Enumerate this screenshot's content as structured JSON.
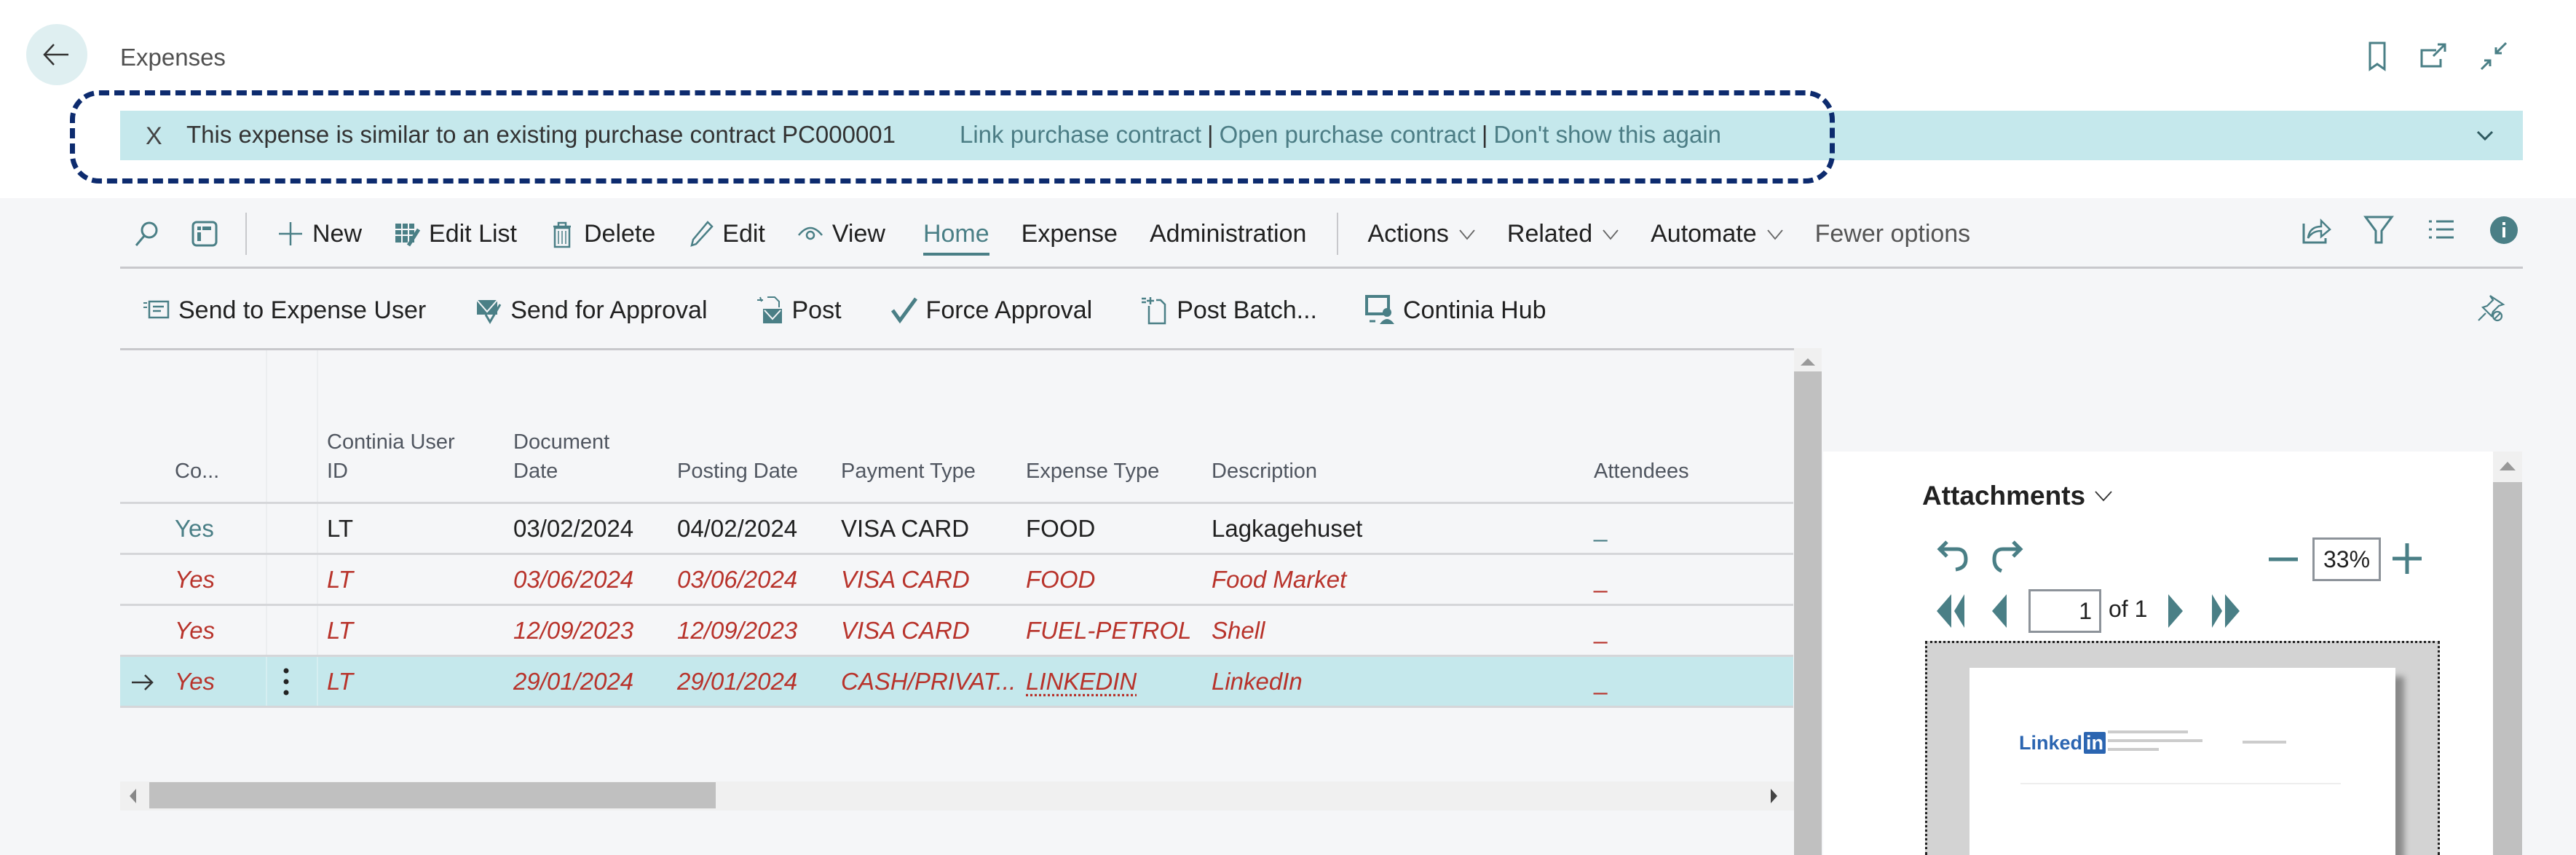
{
  "header": {
    "title": "Expenses",
    "icons": [
      "bookmark-icon",
      "open-new-window-icon",
      "collapse-icon"
    ]
  },
  "banner": {
    "close_glyph": "X",
    "message": "This expense is similar to an existing purchase contract PC000001",
    "actions": [
      "Link purchase contract",
      "Open purchase contract",
      "Don't show this again"
    ],
    "separator": "|",
    "highlight_color": "#0d2b6e",
    "background": "#c5e8ec"
  },
  "action_bar": {
    "buttons": [
      "New",
      "Edit List",
      "Delete",
      "Edit",
      "View"
    ],
    "tabs": [
      {
        "label": "Home",
        "active": true
      },
      {
        "label": "Expense",
        "active": false
      },
      {
        "label": "Administration",
        "active": false
      }
    ],
    "menus": [
      "Actions",
      "Related",
      "Automate"
    ],
    "fewer_options": "Fewer options"
  },
  "promoted_actions": [
    "Send to Expense User",
    "Send for Approval",
    "Post",
    "Force Approval",
    "Post Batch...",
    "Continia Hub"
  ],
  "table": {
    "columns": [
      "Co...",
      "Continia User ID",
      "Document Date",
      "Posting Date",
      "Payment Type",
      "Expense Type",
      "Description",
      "Attendees"
    ],
    "column_lines": {
      "user_id": [
        "Continia User",
        "ID"
      ],
      "doc_date": [
        "Document",
        "Date"
      ]
    },
    "rows": [
      {
        "completed": "Yes",
        "user": "LT",
        "doc_date": "03/02/2024",
        "post_date": "04/02/2024",
        "payment": "VISA CARD",
        "type": "FOOD",
        "description": "Lagkagehuset",
        "attendees": "_",
        "style": "normal",
        "selected": false
      },
      {
        "completed": "Yes",
        "user": "LT",
        "doc_date": "03/06/2024",
        "post_date": "03/06/2024",
        "payment": "VISA CARD",
        "type": "FOOD",
        "description": "Food Market",
        "attendees": "_",
        "style": "error",
        "selected": false
      },
      {
        "completed": "Yes",
        "user": "LT",
        "doc_date": "12/09/2023",
        "post_date": "12/09/2023",
        "payment": "VISA CARD",
        "type": "FUEL-PETROL",
        "description": "Shell",
        "attendees": "_",
        "style": "error",
        "selected": false
      },
      {
        "completed": "Yes",
        "user": "LT",
        "doc_date": "29/01/2024",
        "post_date": "29/01/2024",
        "payment": "CASH/PRIVAT...",
        "type": "LINKEDIN",
        "description": "LinkedIn",
        "attendees": "_",
        "style": "error",
        "selected": true
      }
    ]
  },
  "attachments": {
    "title": "Attachments",
    "zoom": "33%",
    "page": "1",
    "page_of": "of 1",
    "preview_logo": "Linked",
    "preview_logo_badge": "in"
  },
  "colors": {
    "accent": "#4a7f86",
    "error_text": "#b8332b",
    "selected_row": "#c5e8ec"
  }
}
